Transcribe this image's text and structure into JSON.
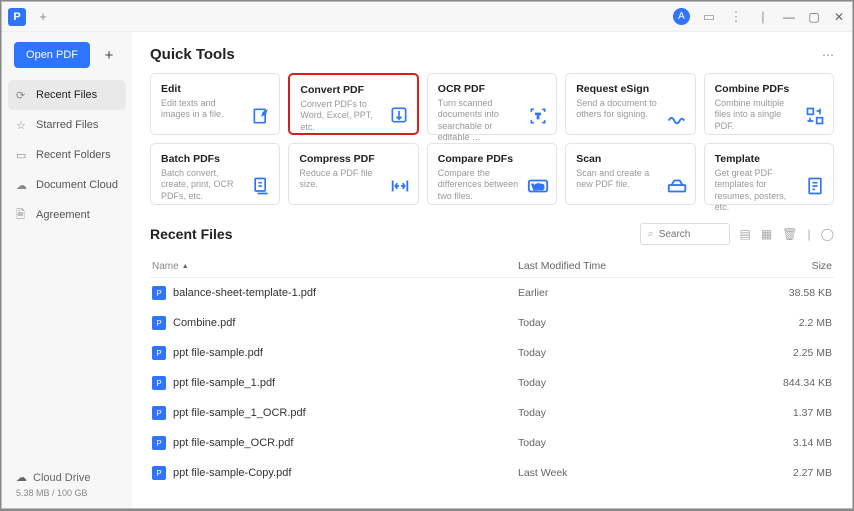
{
  "titlebar": {
    "plus": "+"
  },
  "sidebar": {
    "open_label": "Open PDF",
    "plus": "+",
    "items": [
      {
        "label": "Recent Files",
        "icon": "⟳"
      },
      {
        "label": "Starred Files",
        "icon": "☆"
      },
      {
        "label": "Recent Folders",
        "icon": "▭"
      },
      {
        "label": "Document Cloud",
        "icon": "☁"
      },
      {
        "label": "Agreement",
        "icon": "🗎"
      }
    ],
    "cloud_label": "Cloud Drive",
    "storage": "5.38 MB / 100 GB"
  },
  "quick": {
    "title": "Quick Tools",
    "cards": [
      {
        "title": "Edit",
        "desc": "Edit texts and images in a file."
      },
      {
        "title": "Convert PDF",
        "desc": "Convert PDFs to Word, Excel, PPT, etc."
      },
      {
        "title": "OCR PDF",
        "desc": "Turn scanned documents into searchable or editable …"
      },
      {
        "title": "Request eSign",
        "desc": "Send a document to others for signing."
      },
      {
        "title": "Combine PDFs",
        "desc": "Combine multiple files into a single PDF."
      },
      {
        "title": "Batch PDFs",
        "desc": "Batch convert, create, print, OCR PDFs, etc."
      },
      {
        "title": "Compress PDF",
        "desc": "Reduce a PDF file size."
      },
      {
        "title": "Compare PDFs",
        "desc": "Compare the differences between two files."
      },
      {
        "title": "Scan",
        "desc": "Scan and create a new PDF file."
      },
      {
        "title": "Template",
        "desc": "Get great PDF templates for resumes, posters, etc."
      }
    ]
  },
  "recent": {
    "title": "Recent Files",
    "search_placeholder": "Search",
    "columns": {
      "name": "Name",
      "modified": "Last Modified Time",
      "size": "Size"
    },
    "files": [
      {
        "name": "balance-sheet-template-1.pdf",
        "modified": "Earlier",
        "size": "38.58 KB"
      },
      {
        "name": "Combine.pdf",
        "modified": "Today",
        "size": "2.2 MB"
      },
      {
        "name": "ppt file-sample.pdf",
        "modified": "Today",
        "size": "2.25 MB"
      },
      {
        "name": "ppt file-sample_1.pdf",
        "modified": "Today",
        "size": "844.34 KB"
      },
      {
        "name": "ppt file-sample_1_OCR.pdf",
        "modified": "Today",
        "size": "1.37 MB"
      },
      {
        "name": "ppt file-sample_OCR.pdf",
        "modified": "Today",
        "size": "3.14 MB"
      },
      {
        "name": "ppt file-sample-Copy.pdf",
        "modified": "Last Week",
        "size": "2.27 MB"
      }
    ]
  }
}
